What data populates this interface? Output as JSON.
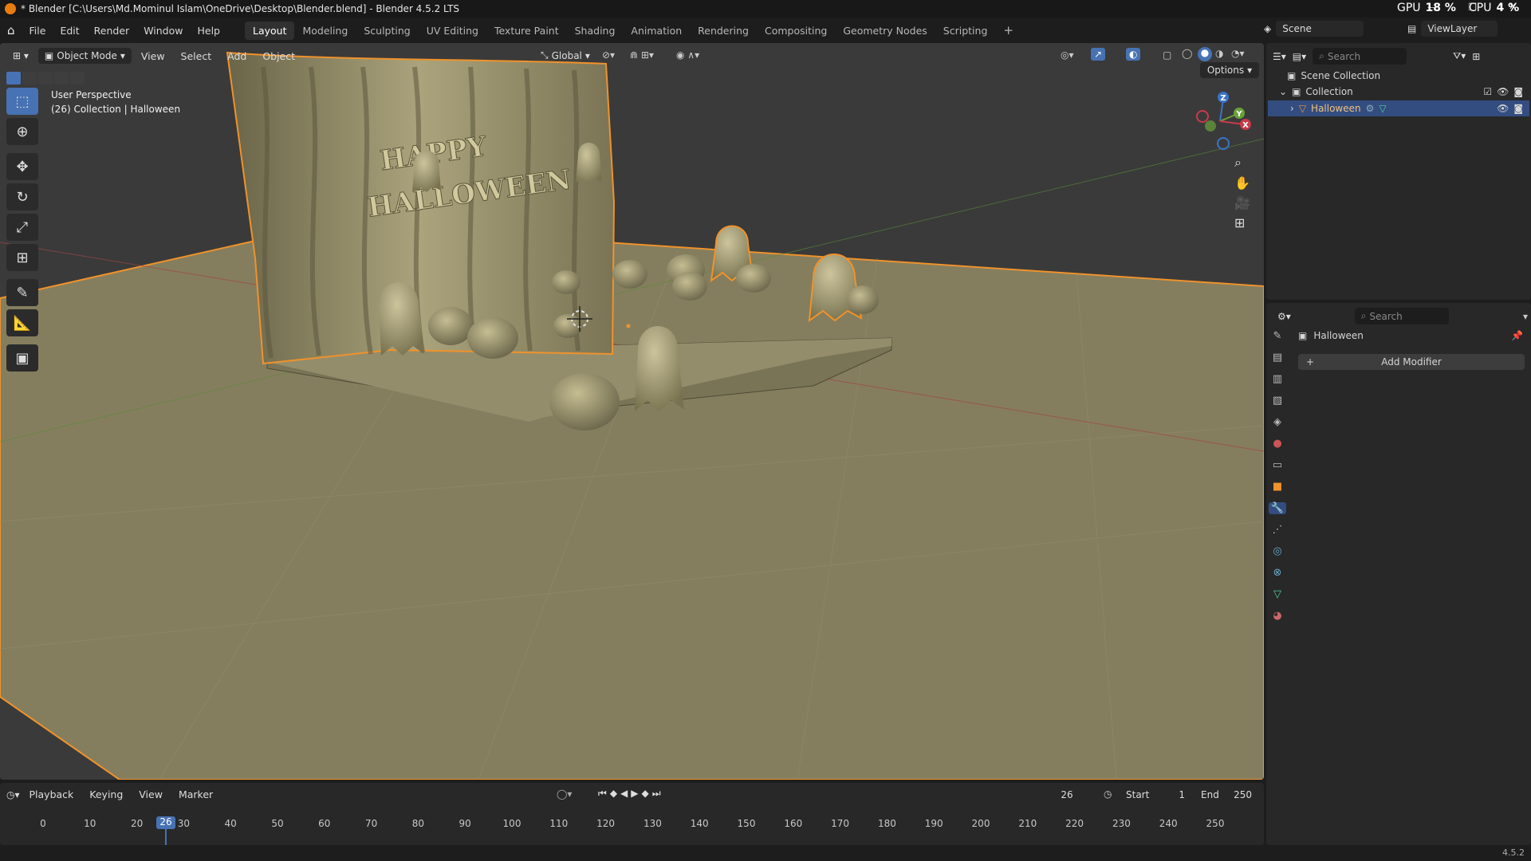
{
  "window": {
    "title": "* Blender [C:\\Users\\Md.Mominul Islam\\OneDrive\\Desktop\\Blender.blend] - Blender 4.5.2 LTS"
  },
  "menus": [
    "File",
    "Edit",
    "Render",
    "Window",
    "Help"
  ],
  "workspaces": [
    "Layout",
    "Modeling",
    "Sculpting",
    "UV Editing",
    "Texture Paint",
    "Shading",
    "Animation",
    "Rendering",
    "Compositing",
    "Geometry Nodes",
    "Scripting"
  ],
  "active_workspace": "Layout",
  "top_right": {
    "scene": "Scene",
    "view_layer": "ViewLayer",
    "gpu_label": "GPU",
    "gpu_value": "18 %",
    "cpu_label": "CPU",
    "cpu_value": "4 %"
  },
  "viewport": {
    "mode": "Object Mode",
    "menus": [
      "View",
      "Select",
      "Add",
      "Object"
    ],
    "orientation": "Global",
    "options_label": "Options",
    "overlay_line1": "User Perspective",
    "overlay_line2": "(26) Collection | Halloween",
    "scene_text_line1": "HAPPY",
    "scene_text_line2": "HALLOWEEN"
  },
  "outliner": {
    "search_placeholder": "Search",
    "scene_collection": "Scene Collection",
    "collection": "Collection",
    "object": "Halloween"
  },
  "properties": {
    "search_placeholder": "Search",
    "object_name": "Halloween",
    "add_modifier": "Add Modifier"
  },
  "timeline": {
    "menus": [
      "Playback",
      "Keying",
      "View",
      "Marker"
    ],
    "current_frame": "26",
    "start_label": "Start",
    "start": "1",
    "end_label": "End",
    "end": "250",
    "ticks": [
      "0",
      "10",
      "20",
      "30",
      "40",
      "50",
      "60",
      "70",
      "80",
      "90",
      "100",
      "110",
      "120",
      "130",
      "140",
      "150",
      "160",
      "170",
      "180",
      "190",
      "200",
      "210",
      "220",
      "230",
      "240",
      "250"
    ]
  },
  "status": {
    "version": "4.5.2"
  },
  "colors": {
    "accent": "#4772b3",
    "selection": "#f0922b",
    "floor": "#857e5e",
    "model": "#8c8766"
  }
}
